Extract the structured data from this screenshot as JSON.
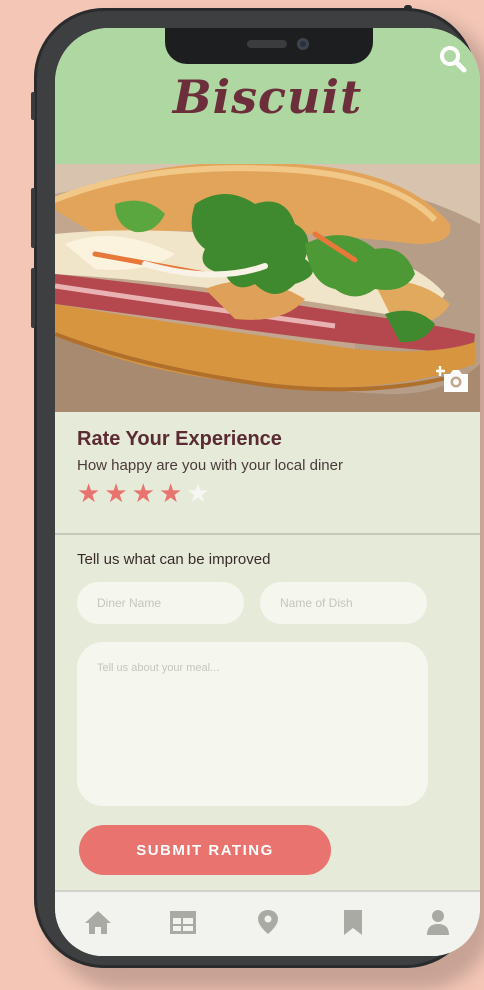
{
  "app": {
    "logo_text": "Biscuit"
  },
  "icons": {
    "search": "search-icon",
    "camera": "camera-plus-icon",
    "tabs": [
      "home-icon",
      "calendar-icon",
      "location-pin-icon",
      "bookmark-icon",
      "user-icon"
    ]
  },
  "rating": {
    "title": "Rate Your Experience",
    "subtitle": "How happy are you with your local diner",
    "stars_filled": 4,
    "stars_total": 5
  },
  "form": {
    "section_label": "Tell us what can be improved",
    "diner_name_placeholder": "Diner Name",
    "dish_name_placeholder": "Name of Dish",
    "meal_placeholder": "Tell us about your meal...",
    "submit_label": "SUBMIT RATING"
  },
  "colors": {
    "header_bg": "#aed7a2",
    "logo": "#6b2e3a",
    "accent": "#e8736f",
    "screen_bg": "#e6ebd9",
    "page_bg": "#f3c6b6",
    "tab_icon": "#a9aaa3"
  }
}
